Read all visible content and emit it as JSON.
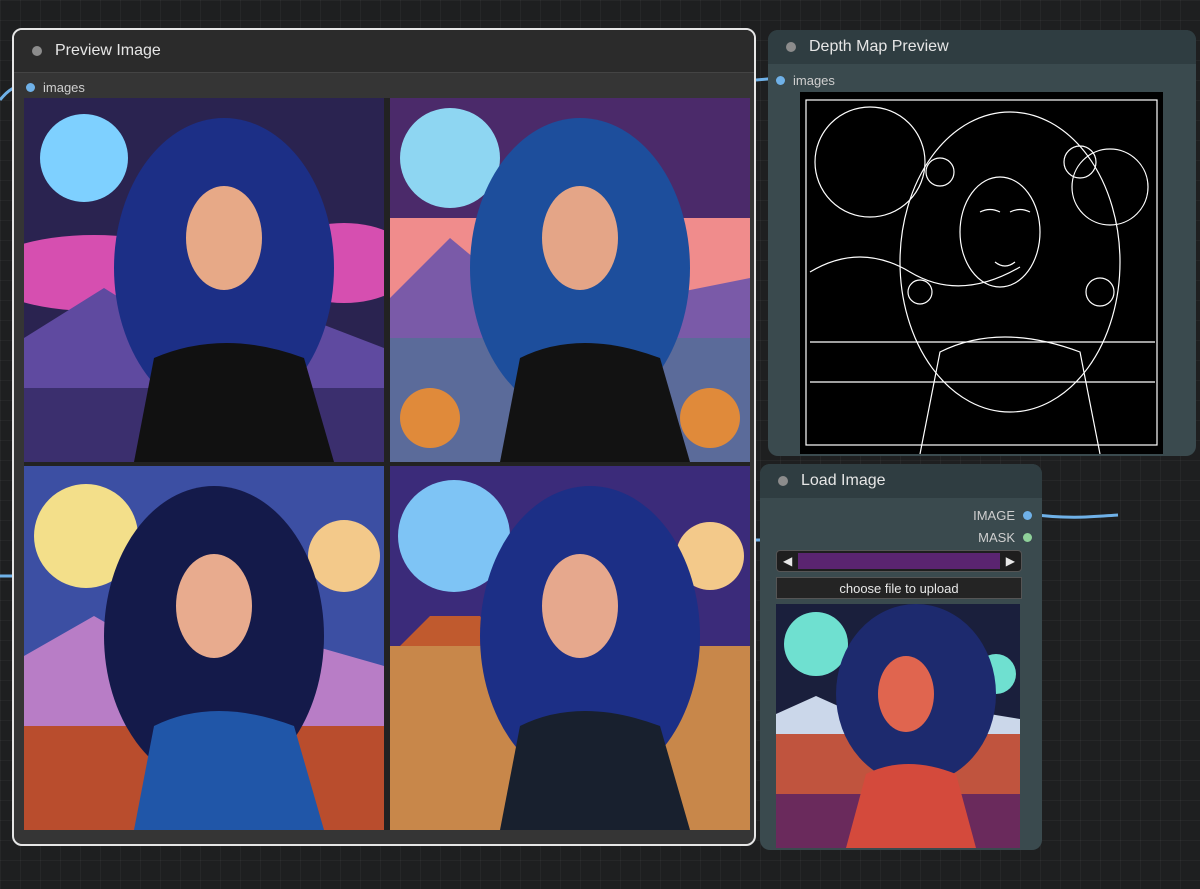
{
  "canvas": {
    "background": "#1e1f20"
  },
  "preview_node": {
    "title": "Preview Image",
    "input_label": "images",
    "tiles": [
      {
        "name": "portrait-moon-pink-clouds",
        "sky": "#2a2350",
        "accent": "#d64fb0",
        "ground": "#5f4aa0",
        "moon": "#7ed0ff"
      },
      {
        "name": "portrait-moon-sunset-river",
        "sky": "#4b2a6a",
        "accent": "#f08c8c",
        "ground": "#5b6b9a",
        "moon": "#8ed6f2"
      },
      {
        "name": "portrait-yellow-moon-desert",
        "sky": "#3c4fa3",
        "accent": "#b87dc6",
        "ground": "#b94d2d",
        "moon": "#f3df8a"
      },
      {
        "name": "portrait-blue-moon-canyon",
        "sky": "#3b2b7a",
        "accent": "#c05a2e",
        "ground": "#c8874a",
        "moon": "#7ec4f5"
      }
    ]
  },
  "depth_node": {
    "title": "Depth Map Preview",
    "input_label": "images"
  },
  "load_node": {
    "title": "Load Image",
    "outputs": [
      {
        "label": "IMAGE",
        "color": "#6fb1e8"
      },
      {
        "label": "MASK",
        "color": "#8fd19a"
      }
    ],
    "slider": {
      "left_arrow": "◀",
      "right_arrow": "▶"
    },
    "upload_label": "choose file to upload"
  },
  "colors": {
    "wire_blue": "#6fb1e8",
    "node_dark": "#353535",
    "node_teal": "#3a4a4e"
  }
}
